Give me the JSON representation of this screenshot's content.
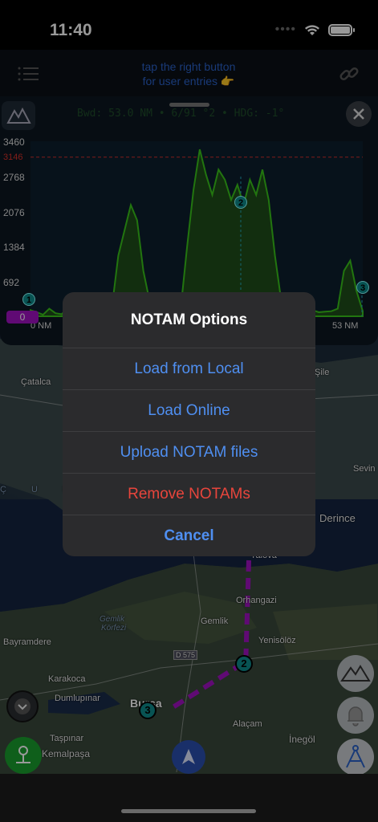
{
  "status_bar": {
    "time": "11:40"
  },
  "top_bar": {
    "hint_line1": "tap the right button",
    "hint_line2": "for user entries 👉"
  },
  "profile": {
    "header": "Bwd: 53.0 NM • 6/91 °2 • HDG: -1°",
    "y_ticks": [
      "3460",
      "3146",
      "2768",
      "2076",
      "1384",
      "692",
      "0"
    ],
    "x_start": "0 NM",
    "x_end": "53 NM",
    "zero_label": "0",
    "markers": [
      "1",
      "2",
      "3"
    ]
  },
  "chart_data": {
    "type": "area",
    "x": [
      0,
      1,
      2,
      3,
      4,
      5,
      6,
      7,
      8,
      9,
      10,
      11,
      12,
      13,
      14,
      15,
      16,
      17,
      18,
      19,
      20,
      21,
      22,
      23,
      24,
      25,
      26,
      27,
      28,
      29,
      30,
      31,
      32,
      33,
      34,
      35,
      36,
      37,
      38,
      39,
      40,
      41,
      42,
      43,
      44,
      45,
      46,
      47,
      48,
      49,
      50,
      51,
      52,
      53
    ],
    "values": [
      120,
      80,
      30,
      150,
      60,
      40,
      200,
      120,
      100,
      80,
      150,
      90,
      140,
      180,
      1200,
      1700,
      2200,
      1900,
      900,
      300,
      150,
      100,
      80,
      60,
      200,
      1400,
      2500,
      3300,
      2800,
      2400,
      2900,
      2700,
      2300,
      2600,
      2200,
      2700,
      2400,
      2900,
      2300,
      1200,
      300,
      150,
      100,
      80,
      60,
      120,
      80,
      90,
      100,
      150,
      900,
      1100,
      500,
      100
    ],
    "ylim": [
      0,
      3460
    ],
    "xlim": [
      0,
      53
    ],
    "x_unit": "NM",
    "reference_line": 3146,
    "series_color": "#39c41a",
    "reference_color": "#d8312b"
  },
  "map": {
    "labels": {
      "catalca": "Çatalca",
      "sile": "Şile",
      "sevin": "Sevin",
      "derince": "Derince",
      "yalova": "Yalova",
      "orhangazi": "Orhangazi",
      "gemlik": "Gemlik",
      "gemlik_korfezi_1": "Gemlik",
      "gemlik_korfezi_2": "Körfezi",
      "yenisoloz": "Yenisölöz",
      "bayramdere": "Bayramdere",
      "karakoca": "Karakoca",
      "dumlupinar": "Dumlupınar",
      "bursa": "Bursa",
      "alacam": "Alaçam",
      "inegol": "İnegöl",
      "tasprinar": "Taşpınar",
      "kemalpasa": "Kemalpaşa",
      "road": "D 575",
      "sea_letters": "Ç U K"
    },
    "route_markers": [
      "2",
      "3"
    ]
  },
  "action_sheet": {
    "title": "NOTAM Options",
    "items": [
      {
        "label": "Load from Local",
        "style": "default"
      },
      {
        "label": "Load Online",
        "style": "default"
      },
      {
        "label": "Upload NOTAM files",
        "style": "default"
      },
      {
        "label": "Remove NOTAMs",
        "style": "destructive"
      }
    ],
    "cancel": "Cancel"
  },
  "colors": {
    "accent_blue": "#4f8ff1",
    "destructive": "#e8453c",
    "route": "#a112c2",
    "marker": "#0e8a8a"
  },
  "icons": {
    "menu": "list-icon",
    "link": "link-icon",
    "close": "close-icon",
    "terrain": "mountain-icon",
    "alert": "bell-icon",
    "compass": "compass-icon",
    "navigate": "navigation-arrow-icon",
    "collapse": "chevron-down-icon",
    "location": "location-pin-icon"
  }
}
